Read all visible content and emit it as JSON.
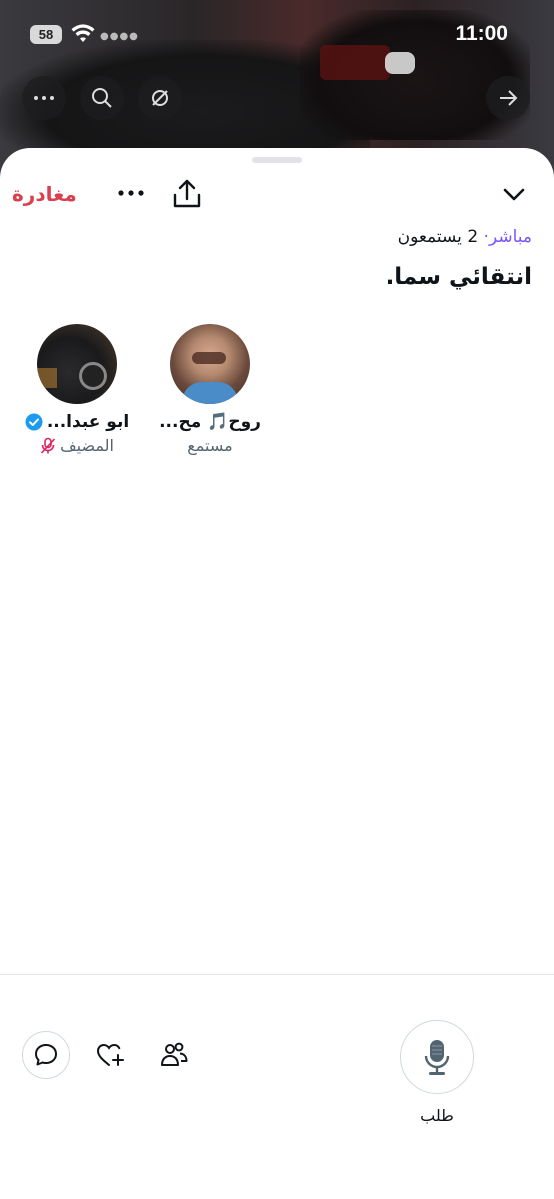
{
  "status_bar": {
    "battery": "58",
    "time": "11:00"
  },
  "header": {
    "leave_label": "مغادرة",
    "live_label": "مباشر·",
    "listeners": "2 يستمعون",
    "title": "انتقائي سما."
  },
  "participants": [
    {
      "name": "روح🎵 مح...",
      "role": "مستمع"
    },
    {
      "name": "ابو عبدا...",
      "role": "المضيف",
      "verified": true,
      "muted": true
    }
  ],
  "footer": {
    "request_label": "طلب"
  },
  "colors": {
    "leave": "#d93f4c",
    "live": "#7856ff",
    "verified": "#1d9bf0",
    "muted": "#e0245e"
  }
}
